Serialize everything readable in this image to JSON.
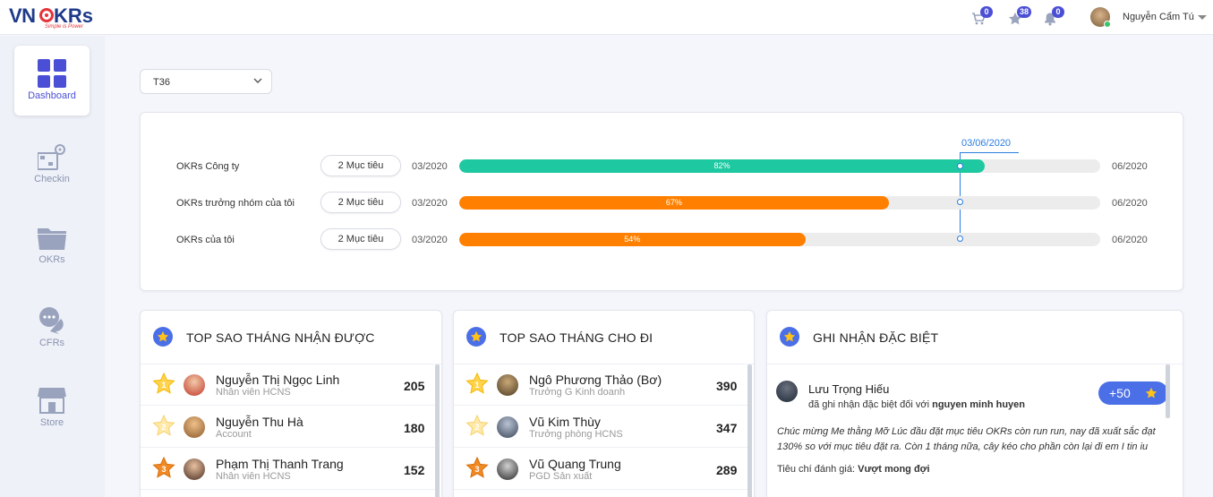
{
  "brand": {
    "logo_left": "VN",
    "logo_right": "KRs",
    "tagline": "Simple is Power"
  },
  "header": {
    "cart_count": "0",
    "star_count": "38",
    "bell_count": "0",
    "user_name": "Nguyễn Cẩm Tú"
  },
  "sidebar": {
    "items": [
      {
        "label": "Dashboard",
        "icon": "dashboard-grid-icon"
      },
      {
        "label": "Checkin",
        "icon": "checkin-icon"
      },
      {
        "label": "OKRs",
        "icon": "folder-icon"
      },
      {
        "label": "CFRs",
        "icon": "chat-icon"
      },
      {
        "label": "Store",
        "icon": "store-icon"
      }
    ]
  },
  "period_select": {
    "value": "T36"
  },
  "progress": {
    "today_label": "03/06/2020",
    "rows": [
      {
        "label": "OKRs Công ty",
        "goals": "2 Mục tiêu",
        "start": "03/2020",
        "end": "06/2020",
        "percent": 82,
        "percent_label": "82%",
        "color": "#1ec8a0"
      },
      {
        "label": "OKRs trưởng nhóm của tôi",
        "goals": "2 Mục tiêu",
        "start": "03/2020",
        "end": "06/2020",
        "percent": 67,
        "percent_label": "67%",
        "color": "#ff8000"
      },
      {
        "label": "OKRs của tôi",
        "goals": "2 Mục tiêu",
        "start": "03/2020",
        "end": "06/2020",
        "percent": 54,
        "percent_label": "54%",
        "color": "#ff8000"
      }
    ]
  },
  "received": {
    "title": "TOP SAO THÁNG NHẬN ĐƯỢC",
    "rows": [
      {
        "rank": "1",
        "name": "Nguyễn Thị Ngọc Linh",
        "role": "Nhân viên HCNS",
        "score": "205"
      },
      {
        "rank": "2",
        "name": "Nguyễn Thu Hà",
        "role": "Account",
        "score": "180"
      },
      {
        "rank": "3",
        "name": "Phạm Thị Thanh Trang",
        "role": "Nhân viên HCNS",
        "score": "152"
      }
    ]
  },
  "given": {
    "title": "TOP SAO THÁNG CHO ĐI",
    "rows": [
      {
        "rank": "1",
        "name": "Ngô Phương Thảo (Bơ)",
        "role": "Trưởng G Kinh doanh",
        "score": "390"
      },
      {
        "rank": "2",
        "name": "Vũ Kim Thùy",
        "role": "Trưởng phòng HCNS",
        "score": "347"
      },
      {
        "rank": "3",
        "name": "Vũ Quang Trung",
        "role": "PGD Sản xuất",
        "score": "289"
      }
    ]
  },
  "special": {
    "title": "GHI NHẬN ĐẶC BIỆT",
    "name": "Lưu Trọng Hiếu",
    "sub_prefix": "đã ghi nhận đặc biệt đối với",
    "sub_target": "nguyen minh huyen",
    "points": "+50",
    "message": "Chúc mừng Me thằng Mỡ Lúc đầu đặt mục tiêu OKRs còn run run, nay đã xuất sắc đạt 130% so với mục tiêu đặt ra. Còn 1 tháng nữa, cây kéo cho phần còn lại đi em I tin iu",
    "criteria_label": "Tiêu chí đánh giá:",
    "criteria_value": "Vượt mong đợi"
  },
  "colors": {
    "accent": "#4b4fd6",
    "brand_blue": "#1e3a8a",
    "brand_red": "#e5343a",
    "teal": "#1ec8a0",
    "orange": "#ff8000",
    "today_line": "#2a7de1"
  }
}
